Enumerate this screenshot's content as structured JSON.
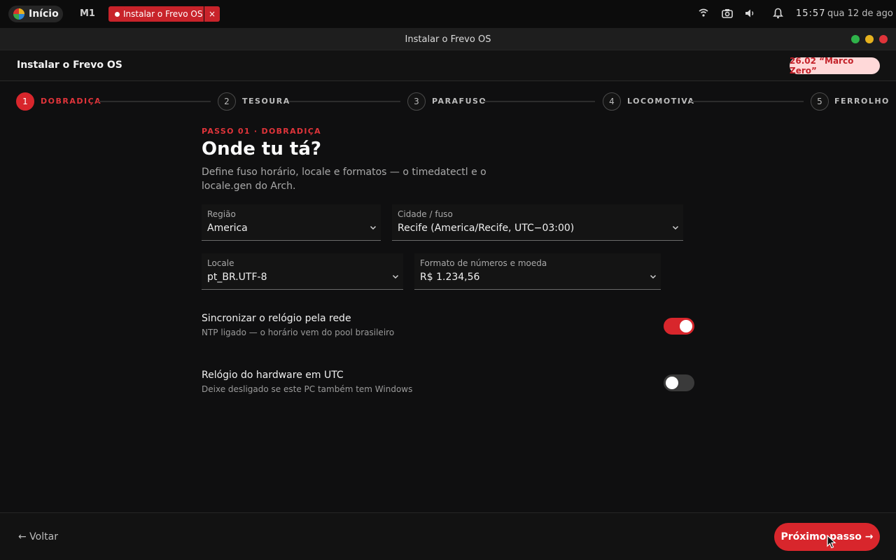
{
  "panel": {
    "start_label": "Início",
    "workspace": "M1",
    "task_label": "Instalar o Frevo OS",
    "task_close": "×",
    "time": "15:57",
    "date": "qua 12 de ago"
  },
  "window": {
    "title": "Instalar o Frevo OS"
  },
  "app": {
    "title": "Instalar o Frevo OS",
    "version_badge": "26.02 “Marco Zero”"
  },
  "steps": [
    {
      "num": "1",
      "label": "DOBRADIÇA",
      "active": true
    },
    {
      "num": "2",
      "label": "TESOURA",
      "active": false
    },
    {
      "num": "3",
      "label": "PARAFUSO",
      "active": false
    },
    {
      "num": "4",
      "label": "LOCOMOTIVA",
      "active": false
    },
    {
      "num": "5",
      "label": "FERROLHO",
      "active": false
    }
  ],
  "main": {
    "kicker": "PASSO 01 · DOBRADIÇA",
    "heading": "Onde tu tá?",
    "description": "Define fuso horário, locale e formatos — o timedatectl e o locale.gen do Arch.",
    "fields": {
      "region": {
        "label": "Região",
        "value": "America"
      },
      "city": {
        "label": "Cidade / fuso",
        "value": "Recife (America/Recife, UTC−03:00)"
      },
      "locale": {
        "label": "Locale",
        "value": "pt_BR.UTF-8"
      },
      "format": {
        "label": "Formato de números e moeda",
        "value": "R$ 1.234,56"
      }
    },
    "toggles": {
      "ntp": {
        "title": "Sincronizar o relógio pela rede",
        "subtitle": "NTP ligado — o horário vem do pool brasileiro",
        "on": true
      },
      "utc": {
        "title": "Relógio do hardware em UTC",
        "subtitle": "Deixe desligado se este PC também tem Windows",
        "on": false
      }
    }
  },
  "footer": {
    "back_label": "← Voltar",
    "next_label": "Próximo passo →"
  },
  "colors": {
    "accent": "#d8262c",
    "badge_bg": "#ffd9d9",
    "background": "#0f0f10"
  }
}
